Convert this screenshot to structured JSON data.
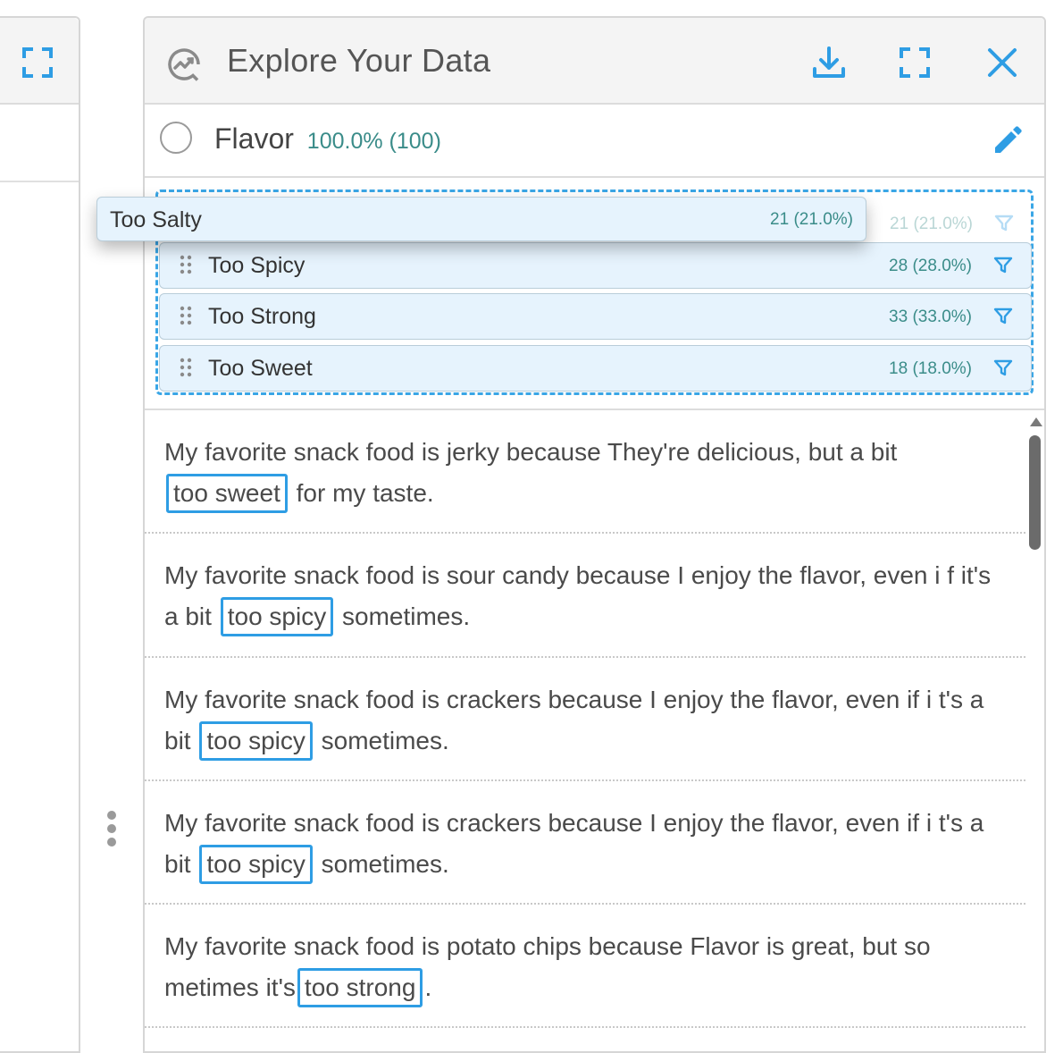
{
  "panel": {
    "title": "Explore Your Data"
  },
  "field": {
    "name": "Flavor",
    "percent": "100.0%",
    "count": "(100)"
  },
  "dragging": {
    "label": "Too Salty",
    "count": "21 (21.0%)"
  },
  "categories": [
    {
      "label": "Too Salty",
      "count": "21 (21.0%)"
    },
    {
      "label": "Too Spicy",
      "count": "28 (28.0%)"
    },
    {
      "label": "Too Strong",
      "count": "33 (33.0%)"
    },
    {
      "label": "Too Sweet",
      "count": "18 (18.0%)"
    }
  ],
  "responses": [
    {
      "before": "My favorite snack food is jerky because They're delicious, but a bit",
      "highlight": "too sweet",
      "after": "for my taste."
    },
    {
      "before": "My favorite snack food is sour candy because I enjoy the flavor, even i f it's a bit",
      "highlight": "too spicy",
      "after": "sometimes."
    },
    {
      "before": "My favorite snack food is crackers because I enjoy the flavor, even if i t's a bit",
      "highlight": "too spicy",
      "after": "sometimes."
    },
    {
      "before": "My favorite snack food is crackers because I enjoy the flavor, even if i t's a bit",
      "highlight": "too spicy",
      "after": "sometimes."
    },
    {
      "before": "My favorite snack food is potato chips because Flavor is great, but so metimes it's",
      "highlight": "too strong",
      "after": "."
    }
  ],
  "colors": {
    "accent": "#3aa6e6",
    "count_text": "#3a8c89",
    "item_bg": "#e6f3fd"
  },
  "icons": {
    "header": "chart-search-icon",
    "download": "download-icon",
    "fullscreen": "fullscreen-icon",
    "close": "close-icon",
    "edit": "pencil-icon",
    "filter": "filter-icon",
    "grip": "drag-handle-icon"
  }
}
